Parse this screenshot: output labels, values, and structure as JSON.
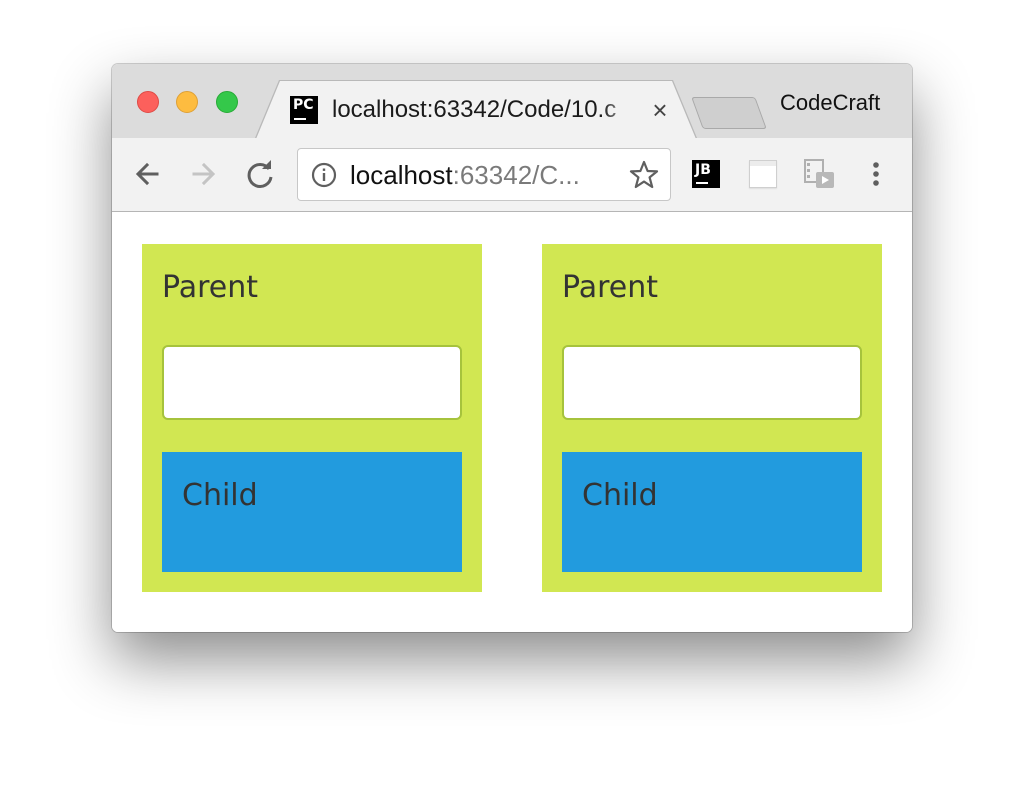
{
  "browser": {
    "tab": {
      "favicon_text": "PC",
      "title": "localhost:63342/Code/10.c",
      "close_glyph": "×"
    },
    "profile_name": "CodeCraft",
    "omnibox": {
      "url_host": "localhost",
      "url_rest": ":63342/C..."
    },
    "extensions": {
      "jetbrains_text": "JB"
    },
    "icons": [
      "back-arrow-icon",
      "forward-arrow-icon",
      "reload-icon",
      "info-icon",
      "star-icon",
      "jetbrains-icon",
      "page-icon",
      "media-icon",
      "more-vert-icon"
    ]
  },
  "page": {
    "panels": [
      {
        "parent_label": "Parent",
        "input_value": "",
        "child_label": "Child"
      },
      {
        "parent_label": "Parent",
        "input_value": "",
        "child_label": "Child"
      }
    ]
  },
  "colors": {
    "parent_bg": "#d1e752",
    "child_bg": "#229bde",
    "input_border": "#a6c33c",
    "text": "#333333"
  }
}
